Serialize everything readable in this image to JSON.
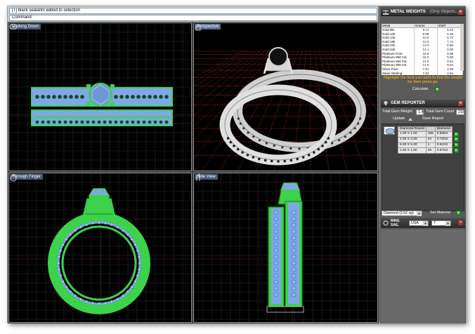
{
  "command": {
    "history": "[T] black sealants added to selection",
    "input": "Command:"
  },
  "viewports": {
    "top_left": "Looking Down",
    "top_right": "Perspective",
    "bottom_left": "Through Finger",
    "bottom_right": "Side View"
  },
  "metal_weights": {
    "title": "METAL WEIGHTS",
    "subtitle": "(Only Objects...",
    "columns": [
      "Metal",
      "Grams",
      "DWT"
    ],
    "rows": [
      [
        "Gold 9kt",
        "9.71",
        "6.22"
      ],
      [
        "Gold 10k",
        "9.88",
        "6.35"
      ],
      [
        "Gold 14k",
        "10.5",
        "6.72"
      ],
      [
        "Gold 18k",
        "12.0",
        "7.73"
      ],
      [
        "Gold 22k",
        "13.3",
        "8.55"
      ],
      [
        "Gold 24k",
        "14.1",
        "9.06"
      ],
      [
        "Platinum Pure",
        "15.5",
        "9.98"
      ],
      [
        "Platinum 950 Ind",
        "15.0",
        "9.68"
      ],
      [
        "Platinum 950 Ind",
        "14.8",
        "9.54"
      ],
      [
        "Platinum 900 Ind",
        "14.8",
        "9.54"
      ],
      [
        "Silver Pure",
        "7.61",
        "4.89"
      ],
      [
        "Silver Sterling",
        "7.53",
        "4.84"
      ]
    ],
    "note": "Highlight the item you want to find the weight for then press go.",
    "calculate_label": "Calculate",
    "go_label": "▸"
  },
  "gem_reporter": {
    "title": "GEM REPORTER",
    "total_weight_label": "Total Gem Weight",
    "total_weight_value": "1.42",
    "total_count_label": "Total Gem Count",
    "total_count_value": "218",
    "update_label": "Update",
    "save_label": "Save Report",
    "columns": [
      "Diamond Round",
      "",
      "Diamond"
    ],
    "rows": [
      [
        "1.00 X 1.00",
        "166",
        "0.836ct"
      ],
      [
        "2.00 X 2.00",
        "24",
        "0.720ct"
      ],
      [
        "5.20 X 5.20",
        "1",
        "0.510ct"
      ],
      [
        "1.50 X 1.50",
        "26",
        "0.975ct"
      ]
    ],
    "material_value": "Diamond (3.52 sg)",
    "set_material_label": "Set Material"
  },
  "ring_size": {
    "label_line1": "RING",
    "label_line2": "SAIL",
    "region_value": "USA",
    "size_value": "7"
  },
  "colors": {
    "wire_green": "#3cd24a",
    "gem_blue": "#7fa7e8",
    "grid": "#2f2f2f",
    "accent_orange": "#e8a321"
  }
}
